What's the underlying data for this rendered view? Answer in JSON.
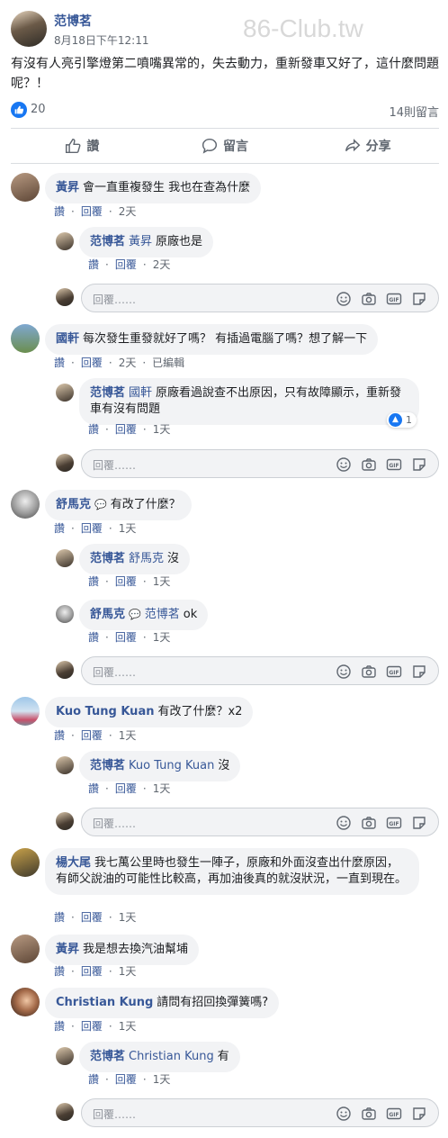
{
  "post": {
    "author": "范博茗",
    "time": "8月18日下午12:11",
    "watermark": "86-Club.tw",
    "text": "有沒有人亮引擎燈第二噴嘴異常的，失去動力，重新發車又好了，這什麼問題呢？！",
    "like_count": "20",
    "comment_count": "14則留言"
  },
  "actions": {
    "like": "讚",
    "comment": "留言",
    "share": "分享"
  },
  "ui": {
    "like": "讚",
    "reply": "回覆",
    "edited": "已編輯",
    "reply_placeholder": "回覆……"
  },
  "comments": [
    {
      "name": "黃昇",
      "text": "會一直重複發生 我也在查為什麼",
      "time": "2天"
    },
    {
      "name": "范博茗",
      "tag": "黃昇",
      "text": "原廠也是",
      "time": "2天"
    },
    {
      "name": "國軒",
      "text": "每次發生重發就好了嗎？ 有插過電腦了嗎？想了解一下",
      "time": "2天"
    },
    {
      "name": "范博茗",
      "tag": "國軒",
      "text": "原廠看過說查不出原因，只有故障顯示，重新發車有沒有問題",
      "time": "1天",
      "likes": "1"
    },
    {
      "name": "舒馬克",
      "text": "有改了什麼？",
      "time": "1天"
    },
    {
      "name": "范博茗",
      "tag": "舒馬克",
      "text": "沒",
      "time": "1天"
    },
    {
      "name": "舒馬克",
      "tag": "范博茗",
      "text": "ok",
      "time": "1天"
    },
    {
      "name": "Kuo Tung Kuan",
      "text": "有改了什麼？x2",
      "time": "1天"
    },
    {
      "name": "范博茗",
      "tag": "Kuo Tung Kuan",
      "text": "沒",
      "time": "1天"
    },
    {
      "name": "楊大尾",
      "text": "我七萬公里時也發生一陣子，原廠和外面沒查出什麼原因，有師父說油的可能性比較高，再加油後真的就沒狀況，一直到現在。",
      "time": "1天"
    },
    {
      "name": "黃昇",
      "text": "我是想去換汽油幫埔",
      "time": "1天"
    },
    {
      "name": "Christian Kung",
      "text": "請問有招回換彈簧嗎?",
      "time": "1天"
    },
    {
      "name": "范博茗",
      "tag": "Christian Kung",
      "text": "有",
      "time": "1天"
    }
  ]
}
